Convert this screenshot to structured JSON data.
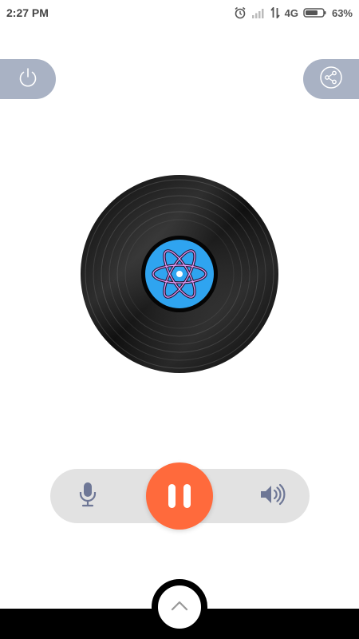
{
  "status_bar": {
    "time": "2:27 PM",
    "network": "4G",
    "battery": "63%"
  },
  "top_buttons": {
    "left_icon": "power-icon",
    "right_icon": "share-icon"
  },
  "player": {
    "record_icon": "vinyl-record-icon",
    "label_icon": "atom-icon",
    "state": "playing"
  },
  "controls": {
    "mic_icon": "microphone-icon",
    "pause_icon": "pause-icon",
    "speaker_icon": "speaker-icon"
  },
  "bottom": {
    "expand_icon": "chevron-up-icon"
  },
  "colors": {
    "accent": "#ff6a3c",
    "side_button": "#a9b2c4",
    "control_bar": "#e2e2e2",
    "record_label": "#2fa4f0"
  }
}
